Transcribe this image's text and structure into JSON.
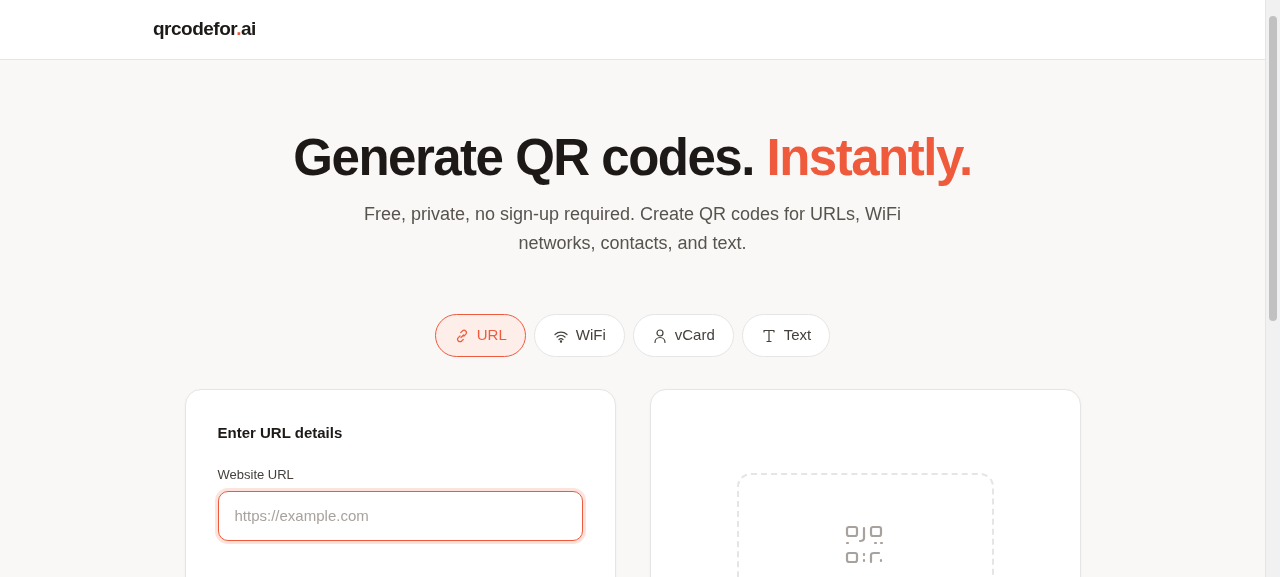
{
  "header": {
    "logo": {
      "name": "qrcodefor",
      "dot": ".",
      "tld": "ai"
    }
  },
  "hero": {
    "title": "Generate QR codes.",
    "accent": "Instantly.",
    "subtitle": "Free, private, no sign-up required. Create QR codes for URLs, WiFi networks, contacts, and text."
  },
  "tabs": [
    {
      "label": "URL",
      "kind": "link",
      "selected": true
    },
    {
      "label": "WiFi",
      "kind": "wifi",
      "selected": false
    },
    {
      "label": "vCard",
      "kind": "person",
      "selected": false
    },
    {
      "label": "Text",
      "kind": "text",
      "selected": false
    }
  ],
  "form": {
    "title": "Enter URL details",
    "field_label": "Website URL",
    "placeholder": "https://example.com"
  }
}
